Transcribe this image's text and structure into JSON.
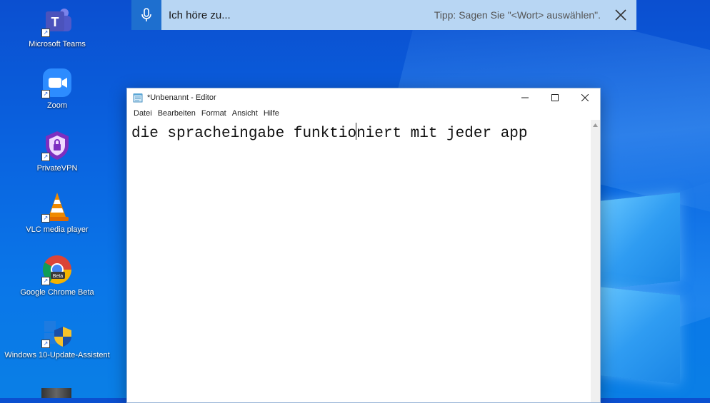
{
  "desktop": {
    "icons": [
      {
        "label": "Microsoft Teams",
        "icon": "teams-icon"
      },
      {
        "label": "Zoom",
        "icon": "zoom-icon"
      },
      {
        "label": "PrivateVPN",
        "icon": "privatevpn-icon"
      },
      {
        "label": "VLC media player",
        "icon": "vlc-icon"
      },
      {
        "label": "Google Chrome Beta",
        "icon": "chrome-beta-icon",
        "badge": "Beta"
      },
      {
        "label": "Windows 10-Update-Assistent",
        "icon": "windows-update-icon"
      }
    ]
  },
  "speech_bar": {
    "status": "Ich höre zu...",
    "tip": "Tipp: Sagen Sie \"<Wort> auswählen\".",
    "accent": "#1e6fcf"
  },
  "notepad": {
    "title": "*Unbenannt - Editor",
    "menu": [
      "Datei",
      "Bearbeiten",
      "Format",
      "Ansicht",
      "Hilfe"
    ],
    "text_before_caret": "die spracheingabe funktio",
    "text_after_caret": "niert mit jeder app"
  }
}
